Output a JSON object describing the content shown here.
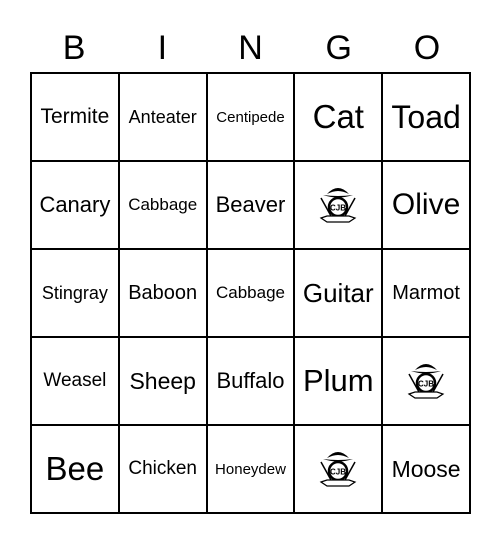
{
  "header": [
    "B",
    "I",
    "N",
    "G",
    "O"
  ],
  "cells": [
    {
      "text": "Termite",
      "size": 21
    },
    {
      "text": "Anteater",
      "size": 18
    },
    {
      "text": "Centipede",
      "size": 15
    },
    {
      "text": "Cat",
      "size": 33
    },
    {
      "text": "Toad",
      "size": 32
    },
    {
      "text": "Canary",
      "size": 22
    },
    {
      "text": "Cabbage",
      "size": 17
    },
    {
      "text": "Beaver",
      "size": 22
    },
    {
      "logo": "CJB"
    },
    {
      "text": "Olive",
      "size": 30
    },
    {
      "text": "Stingray",
      "size": 18
    },
    {
      "text": "Baboon",
      "size": 20
    },
    {
      "text": "Cabbage",
      "size": 17
    },
    {
      "text": "Guitar",
      "size": 26
    },
    {
      "text": "Marmot",
      "size": 20
    },
    {
      "text": "Weasel",
      "size": 19
    },
    {
      "text": "Sheep",
      "size": 23
    },
    {
      "text": "Buffalo",
      "size": 22
    },
    {
      "text": "Plum",
      "size": 31
    },
    {
      "logo": "CJB"
    },
    {
      "text": "Bee",
      "size": 33
    },
    {
      "text": "Chicken",
      "size": 19
    },
    {
      "text": "Honeydew",
      "size": 15
    },
    {
      "logo": "CJB"
    },
    {
      "text": "Moose",
      "size": 23
    }
  ]
}
